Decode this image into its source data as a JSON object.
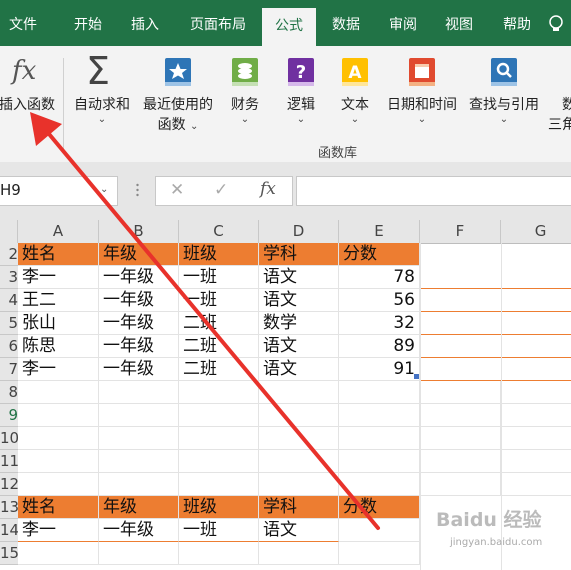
{
  "tabs": [
    {
      "label": "文件",
      "active": false
    },
    {
      "label": "开始",
      "active": false
    },
    {
      "label": "插入",
      "active": false
    },
    {
      "label": "页面布局",
      "active": false
    },
    {
      "label": "公式",
      "active": true
    },
    {
      "label": "数据",
      "active": false
    },
    {
      "label": "审阅",
      "active": false
    },
    {
      "label": "视图",
      "active": false
    },
    {
      "label": "帮助",
      "active": false
    }
  ],
  "ribbon": {
    "insert_function": {
      "icon_text": "fx",
      "label": "插入函数",
      "icon": "fx-icon"
    },
    "buttons": [
      {
        "label1": "自动求和",
        "label2": "",
        "caret": "⌄",
        "icon": "sigma-icon",
        "color": "#444444"
      },
      {
        "label1": "最近使用的",
        "label2": "函数",
        "caret": "⌄",
        "icon": "star-book-icon",
        "color": "#2e75b6"
      },
      {
        "label1": "财务",
        "label2": "",
        "caret": "⌄",
        "icon": "money-book-icon",
        "color": "#70ad47"
      },
      {
        "label1": "逻辑",
        "label2": "",
        "caret": "⌄",
        "icon": "question-book-icon",
        "color": "#7030a0"
      },
      {
        "label1": "文本",
        "label2": "",
        "caret": "⌄",
        "icon": "text-book-icon",
        "color": "#ffc000"
      },
      {
        "label1": "日期和时间",
        "label2": "",
        "caret": "⌄",
        "icon": "calendar-book-icon",
        "color": "#e04a2f"
      },
      {
        "label1": "查找与引用",
        "label2": "",
        "caret": "⌄",
        "icon": "search-book-icon",
        "color": "#2e75b6"
      },
      {
        "label1": "数",
        "label2": "三角",
        "caret": "",
        "icon": "math-book-icon",
        "color": "#2e75b6"
      }
    ],
    "group_label": "函数库"
  },
  "formula_bar": {
    "name_box": "H9",
    "cancel": "✕",
    "enter": "✓",
    "fx": "fx",
    "value": ""
  },
  "columns": [
    "A",
    "B",
    "C",
    "D",
    "E",
    "F",
    "G"
  ],
  "rows": [
    {
      "n": "2",
      "cells": [
        "姓名",
        "年级",
        "班级",
        "学科",
        "分数"
      ],
      "header": true
    },
    {
      "n": "3",
      "cells": [
        "李一",
        "一年级",
        "一班",
        "语文",
        "78"
      ],
      "header": false
    },
    {
      "n": "4",
      "cells": [
        "王二",
        "一年级",
        "一班",
        "语文",
        "56"
      ],
      "header": false
    },
    {
      "n": "5",
      "cells": [
        "张山",
        "一年级",
        "二班",
        "数学",
        "32"
      ],
      "header": false
    },
    {
      "n": "6",
      "cells": [
        "陈思",
        "一年级",
        "二班",
        "语文",
        "89"
      ],
      "header": false
    },
    {
      "n": "7",
      "cells": [
        "李一",
        "一年级",
        "二班",
        "语文",
        "91"
      ],
      "header": false
    },
    {
      "n": "8",
      "cells": [
        "",
        "",
        "",
        "",
        ""
      ],
      "header": false
    },
    {
      "n": "9",
      "cells": [
        "",
        "",
        "",
        "",
        ""
      ],
      "header": false
    },
    {
      "n": "10",
      "cells": [
        "",
        "",
        "",
        "",
        ""
      ],
      "header": false
    },
    {
      "n": "11",
      "cells": [
        "",
        "",
        "",
        "",
        ""
      ],
      "header": false
    },
    {
      "n": "12",
      "cells": [
        "",
        "",
        "",
        "",
        ""
      ],
      "header": false
    },
    {
      "n": "13",
      "cells": [
        "姓名",
        "年级",
        "班级",
        "学科",
        "分数"
      ],
      "header": true
    },
    {
      "n": "14",
      "cells": [
        "李一",
        "一年级",
        "一班",
        "语文",
        ""
      ],
      "header": false
    },
    {
      "n": "15",
      "cells": [
        "",
        "",
        "",
        "",
        ""
      ],
      "header": false
    }
  ],
  "watermark": {
    "brand": "Baidu 经验",
    "url": "jingyan.baidu.com"
  },
  "colors": {
    "ribbon_green": "#217346",
    "table_header": "#ed7d31",
    "annotation_arrow": "#e8322b"
  }
}
